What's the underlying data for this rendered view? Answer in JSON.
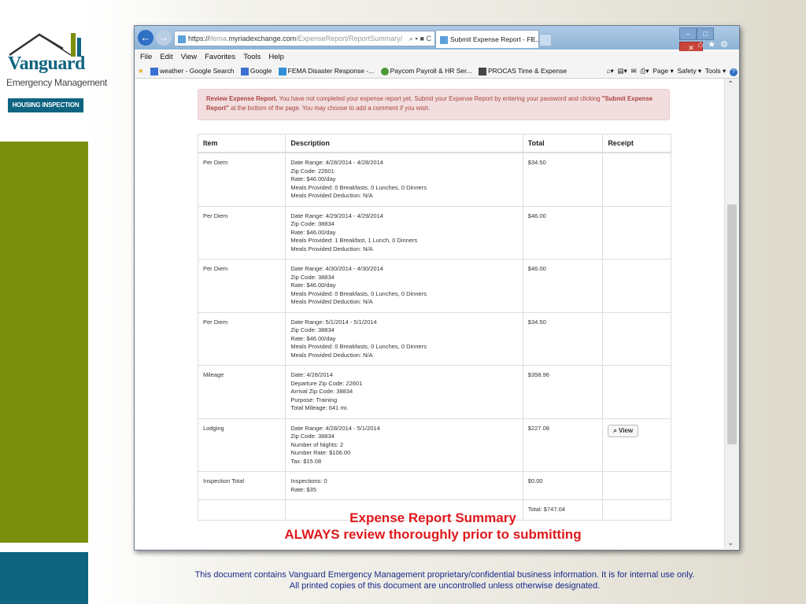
{
  "logo": {
    "brand": "Vanguard",
    "subtitle": "Emergency Management",
    "tagline": "HOUSING INSPECTION SERVICES"
  },
  "browser": {
    "url_prefix": "https://",
    "url_dim1": "ifema.",
    "url_domain": "myriadexchange.com",
    "url_path": "/ExpenseReport/ReportSummary/",
    "url_ctrls": "⌕ ▾ ■ C",
    "tab_title": "Submit Expense Report - FE...",
    "tab_close": "×",
    "menu": [
      "File",
      "Edit",
      "View",
      "Favorites",
      "Tools",
      "Help"
    ],
    "favorites": [
      {
        "label": "weather - Google Search",
        "color": "#3b6fd4"
      },
      {
        "label": "Google",
        "color": "#3b6fd4"
      },
      {
        "label": "FEMA Disaster Response -...",
        "color": "#2f8fd8"
      },
      {
        "label": "Paycom  Payroll & HR Ser...",
        "color": "#4a9a3a"
      },
      {
        "label": "PROCAS Time & Expense",
        "color": "#444444"
      }
    ],
    "command_bar": [
      "Page ▾",
      "Safety ▾",
      "Tools ▾"
    ]
  },
  "alert": {
    "bold_lead": "Review Expense Report.",
    "text": " You have not completed your expense report yet. Submit your Expense Report by entering your password and clicking ",
    "bold_action": "\"Submit Expense Report\"",
    "tail": " at the bottom of the page. You may choose to add a comment if you wish."
  },
  "table": {
    "headers": [
      "Item",
      "Description",
      "Total",
      "Receipt"
    ],
    "rows": [
      {
        "item": "Per Diem",
        "desc": [
          "Date Range:  4/28/2014 - 4/28/2014",
          "Zip Code:  22601",
          "Rate:  $46.00/day",
          "Meals Provided:  0 Breakfasts,  0 Lunches,  0 Dinners",
          "Meals Provided Deduction:  N/A"
        ],
        "total": "$34.50",
        "receipt": ""
      },
      {
        "item": "Per Diem",
        "desc": [
          "Date Range:  4/29/2014 - 4/29/2014",
          "Zip Code:  38834",
          "Rate:  $46.00/day",
          "Meals Provided:  1 Breakfast,  1 Lunch,  0 Dinners",
          "Meals Provided Deduction:  N/A"
        ],
        "total": "$46.00",
        "receipt": ""
      },
      {
        "item": "Per Diem",
        "desc": [
          "Date Range:  4/30/2014 - 4/30/2014",
          "Zip Code:  38834",
          "Rate:  $46.00/day",
          "Meals Provided:  0 Breakfasts,  0 Lunches,  0 Dinners",
          "Meals Provided Deduction:  N/A"
        ],
        "total": "$46.00",
        "receipt": ""
      },
      {
        "item": "Per Diem",
        "desc": [
          "Date Range:  5/1/2014 - 5/1/2014",
          "Zip Code:  38834",
          "Rate:  $46.00/day",
          "Meals Provided:  0 Breakfasts,  0 Lunches,  0 Dinners",
          "Meals Provided Deduction:  N/A"
        ],
        "total": "$34.50",
        "receipt": ""
      },
      {
        "item": "Mileage",
        "desc": [
          "Date:  4/28/2014",
          "Departure Zip Code:  22601",
          "Arrival Zip Code:  38834",
          "Purpose:  Training",
          "Total Mileage:  641 mi."
        ],
        "total": "$358.96",
        "receipt": ""
      },
      {
        "item": "Lodging",
        "desc": [
          "Date Range:  4/28/2014 - 5/1/2014",
          "Zip Code:  38834",
          "Number of Nights:  2",
          "Number Rate:  $106.00",
          "Tax:  $15.08"
        ],
        "total": "$227.08",
        "receipt": "View"
      },
      {
        "item": "Inspection Total",
        "desc": [
          "Inspections:  0",
          "Rate:  $35"
        ],
        "total": "$0.00",
        "receipt": ""
      },
      {
        "item": "",
        "desc": [],
        "total": "Total:  $747.04",
        "receipt": ""
      }
    ]
  },
  "overlay": {
    "line1": "Expense Report Summary",
    "line2": "ALWAYS review thoroughly prior to submitting"
  },
  "footer": {
    "line1": "This document contains Vanguard Emergency Management proprietary/confidential business information. It is for internal use only.",
    "line2": "All printed copies of this document are uncontrolled unless otherwise designated."
  }
}
